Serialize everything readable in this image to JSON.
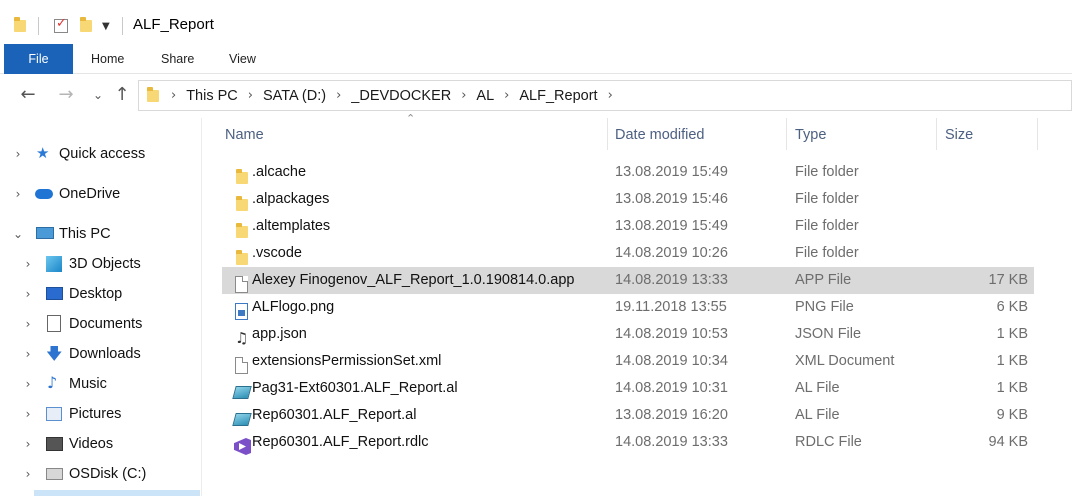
{
  "window": {
    "title": "ALF_Report"
  },
  "ribbon": {
    "tabs": [
      "File",
      "Home",
      "Share",
      "View"
    ]
  },
  "address": {
    "crumbs": [
      "This PC",
      "SATA (D:)",
      "_DEVDOCKER",
      "AL",
      "ALF_Report"
    ]
  },
  "sidebar": {
    "items": [
      {
        "label": "Quick access",
        "icon": "star-icon"
      },
      {
        "label": "OneDrive",
        "icon": "cloud-icon"
      },
      {
        "label": "This PC",
        "icon": "computer-icon"
      },
      {
        "label": "3D Objects",
        "icon": "cube-icon"
      },
      {
        "label": "Desktop",
        "icon": "desktop-icon"
      },
      {
        "label": "Documents",
        "icon": "documents-icon"
      },
      {
        "label": "Downloads",
        "icon": "download-icon"
      },
      {
        "label": "Music",
        "icon": "music-icon"
      },
      {
        "label": "Pictures",
        "icon": "pictures-icon"
      },
      {
        "label": "Videos",
        "icon": "videos-icon"
      },
      {
        "label": "OSDisk (C:)",
        "icon": "disk-icon"
      }
    ]
  },
  "columns": {
    "name": "Name",
    "date": "Date modified",
    "type": "Type",
    "size": "Size"
  },
  "files": [
    {
      "name": ".alcache",
      "date": "13.08.2019 15:49",
      "type": "File folder",
      "size": "",
      "icon": "folder-icon"
    },
    {
      "name": ".alpackages",
      "date": "13.08.2019 15:46",
      "type": "File folder",
      "size": "",
      "icon": "folder-icon"
    },
    {
      "name": ".altemplates",
      "date": "13.08.2019 15:49",
      "type": "File folder",
      "size": "",
      "icon": "folder-icon"
    },
    {
      "name": ".vscode",
      "date": "14.08.2019 10:26",
      "type": "File folder",
      "size": "",
      "icon": "folder-icon"
    },
    {
      "name": "Alexey Finogenov_ALF_Report_1.0.190814.0.app",
      "date": "14.08.2019 13:33",
      "type": "APP File",
      "size": "17 KB",
      "icon": "file-icon"
    },
    {
      "name": "ALFlogo.png",
      "date": "19.11.2018 13:55",
      "type": "PNG File",
      "size": "6 KB",
      "icon": "image-file-icon"
    },
    {
      "name": "app.json",
      "date": "14.08.2019 10:53",
      "type": "JSON File",
      "size": "1 KB",
      "icon": "json-file-icon"
    },
    {
      "name": "extensionsPermissionSet.xml",
      "date": "14.08.2019 10:34",
      "type": "XML Document",
      "size": "1 KB",
      "icon": "file-icon"
    },
    {
      "name": "Pag31-Ext60301.ALF_Report.al",
      "date": "14.08.2019 10:31",
      "type": "AL File",
      "size": "1 KB",
      "icon": "al-file-icon"
    },
    {
      "name": "Rep60301.ALF_Report.al",
      "date": "13.08.2019 16:20",
      "type": "AL File",
      "size": "9 KB",
      "icon": "al-file-icon"
    },
    {
      "name": "Rep60301.ALF_Report.rdlc",
      "date": "14.08.2019 13:33",
      "type": "RDLC File",
      "size": "94 KB",
      "icon": "visual-studio-file-icon"
    }
  ],
  "colors": {
    "file_tab": "#1a63b8",
    "selected_row": "#d9d9d9",
    "header_text": "#4d6082"
  }
}
